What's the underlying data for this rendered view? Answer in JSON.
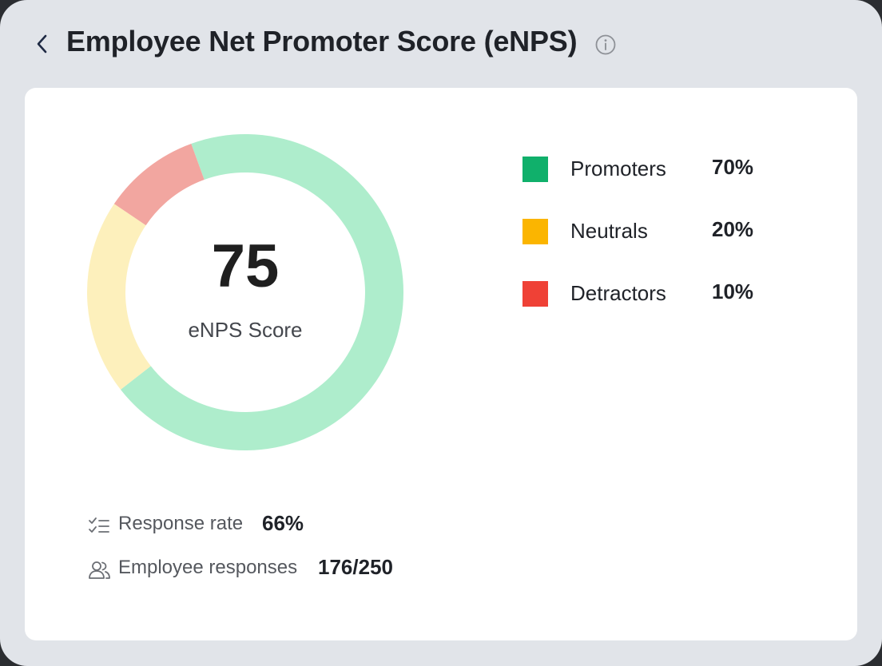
{
  "header": {
    "title": "Employee Net Promoter Score (eNPS)"
  },
  "score": {
    "value": "75",
    "label": "eNPS Score"
  },
  "legend": [
    {
      "label": "Promoters",
      "value": "70%",
      "color": "#10b06b"
    },
    {
      "label": "Neutrals",
      "value": "20%",
      "color": "#fbb500"
    },
    {
      "label": "Detractors",
      "value": "10%",
      "color": "#ef4136"
    }
  ],
  "chart_data": {
    "type": "pie",
    "categories": [
      "Promoters",
      "Neutrals",
      "Detractors"
    ],
    "values": [
      70,
      20,
      10
    ],
    "donut_colors": [
      "#aeedcc",
      "#fdf0bc",
      "#f2a6a0"
    ],
    "center_text": "75",
    "center_label": "eNPS Score"
  },
  "stats": {
    "response_rate_label": "Response rate",
    "response_rate_value": "66%",
    "responses_label": "Employee responses",
    "responses_value": "176/250"
  },
  "icons": {
    "back": "chevron-left-icon",
    "info": "info-icon",
    "checklist": "checklist-icon",
    "users": "users-icon"
  }
}
